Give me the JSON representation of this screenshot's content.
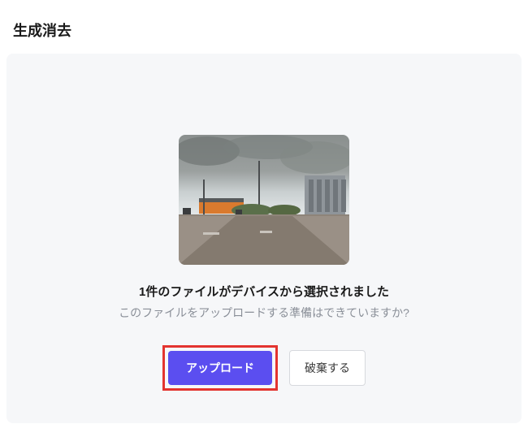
{
  "header": {
    "title": "生成消去"
  },
  "upload": {
    "file_status": "1件のファイルがデバイスから選択されました",
    "prompt": "このファイルをアップロードする準備はできていますか?",
    "upload_button": "アップロード",
    "discard_button": "破棄する"
  }
}
